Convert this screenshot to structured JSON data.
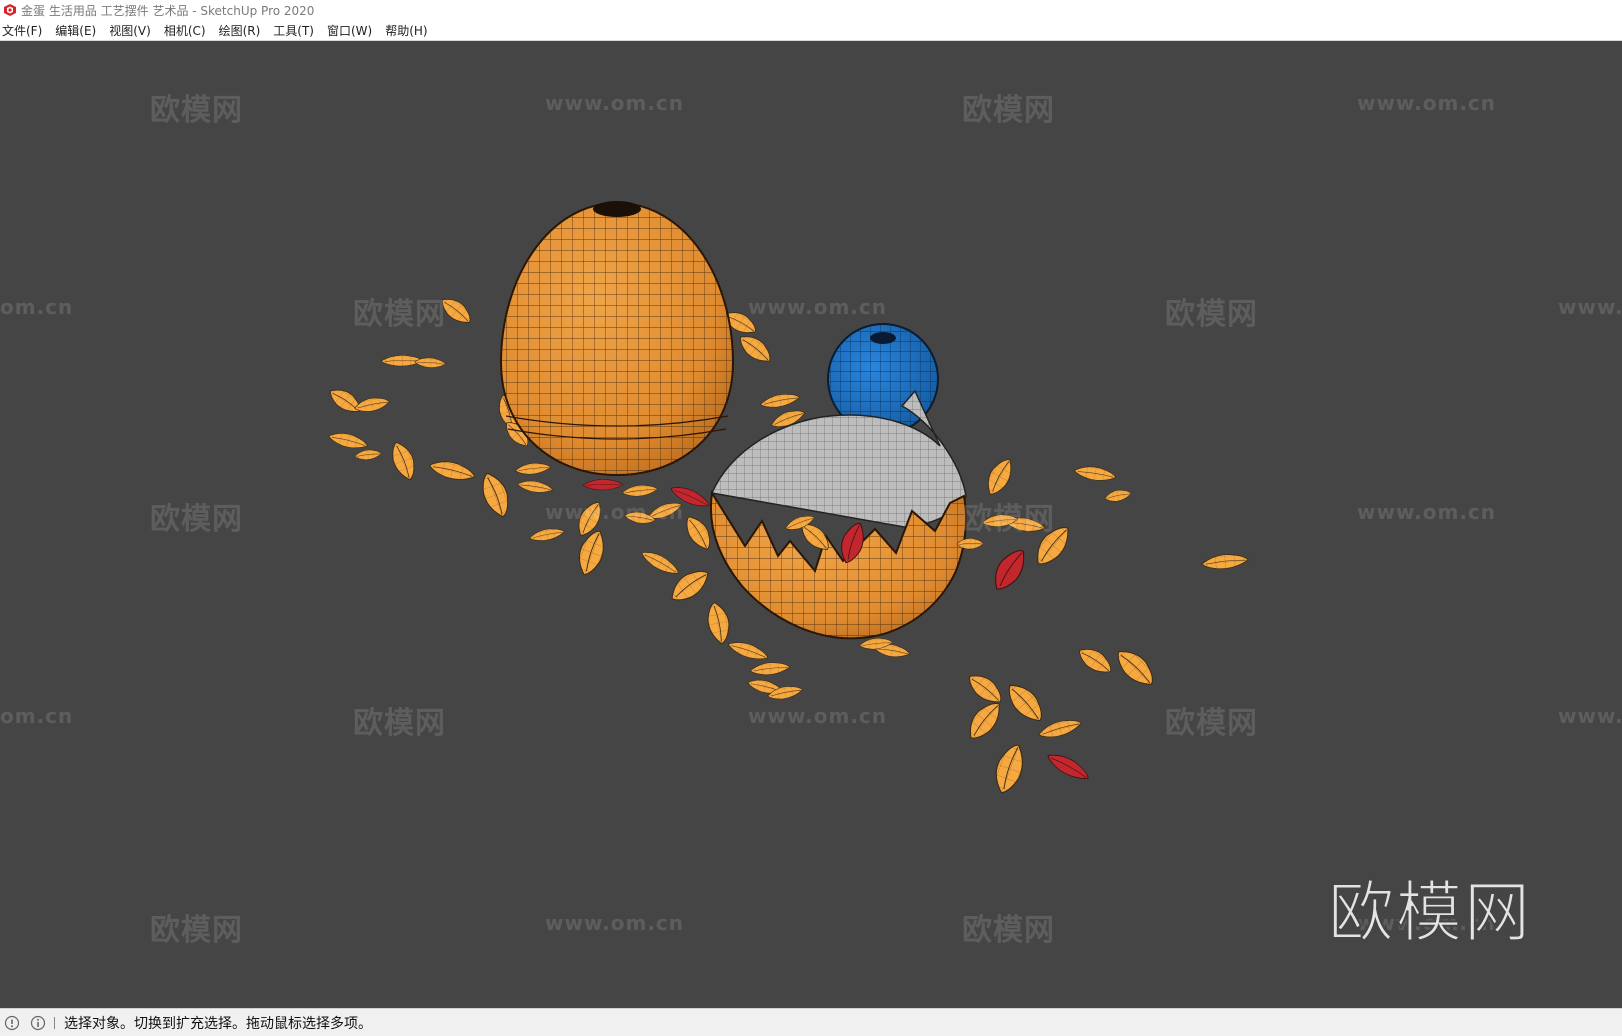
{
  "window": {
    "title": "金蛋 生活用品 工艺摆件 艺术品 - SketchUp Pro 2020",
    "app_icon": "sketchup-logo-icon"
  },
  "menu": {
    "items": [
      {
        "label": "文件(F)"
      },
      {
        "label": "编辑(E)"
      },
      {
        "label": "视图(V)"
      },
      {
        "label": "相机(C)"
      },
      {
        "label": "绘图(R)"
      },
      {
        "label": "工具(T)"
      },
      {
        "label": "窗口(W)"
      },
      {
        "label": "帮助(H)"
      }
    ]
  },
  "watermarks": {
    "brand": "欧模网",
    "url": "www.om.cn",
    "url_cropped_left": "om.cn",
    "url_cropped_right": "www."
  },
  "statusbar": {
    "icons": [
      "geolocation-icon",
      "info-icon"
    ],
    "message": "选择对象。切换到扩充选择。拖动鼠标选择多项。"
  },
  "colors": {
    "viewport_bg": "#454545",
    "gold_egg": "#e8963a",
    "flake": "#f7a941",
    "red_flake": "#c1272d",
    "blue_ball": "#1e73c8",
    "shell_inner": "#c4c4c4"
  }
}
